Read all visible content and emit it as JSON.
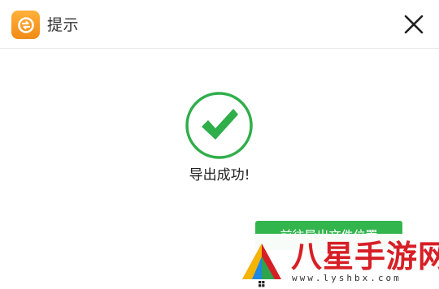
{
  "dialog": {
    "title": "提示",
    "close_icon": "close-icon",
    "app_logo_icon": "app-logo-icon"
  },
  "content": {
    "status_icon": "check-circle-icon",
    "message": "导出成功!",
    "open_folder_button": "前往导出文件位置"
  },
  "watermark": {
    "brand": "八星手游网",
    "url": "www.lyshbx.com"
  },
  "colors": {
    "accent_orange": "#f39a1d",
    "success_green": "#2fae4a",
    "button_green": "#33b54d",
    "watermark_red": "#d71f26"
  }
}
